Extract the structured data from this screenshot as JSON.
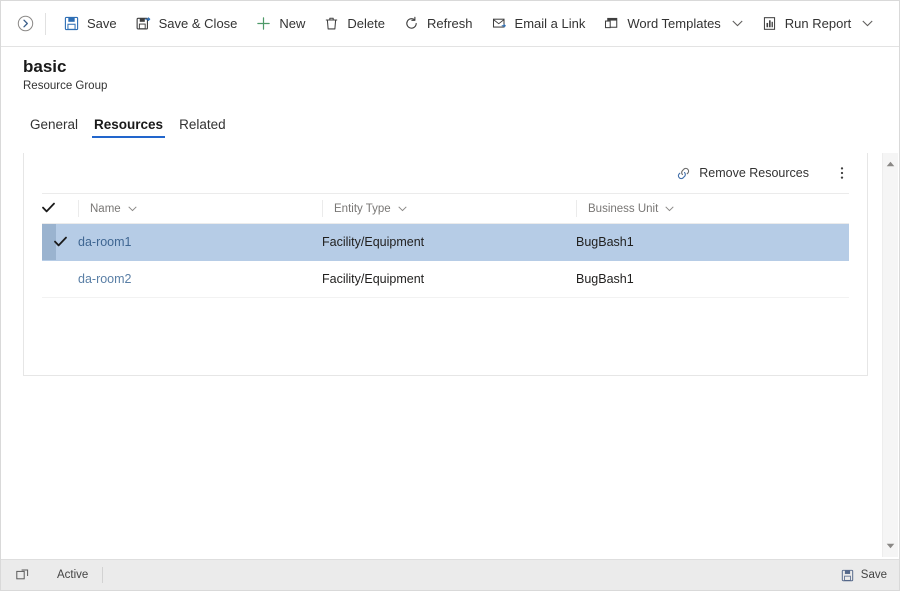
{
  "command_bar": {
    "expand_icon": "chevron-circle-right-icon",
    "buttons": [
      {
        "label": "Save",
        "icon": "save-disk-icon",
        "has_caret": false
      },
      {
        "label": "Save & Close",
        "icon": "save-and-close-icon",
        "has_caret": false
      },
      {
        "label": "New",
        "icon": "plus-icon",
        "has_caret": false
      },
      {
        "label": "Delete",
        "icon": "trash-icon",
        "has_caret": false
      },
      {
        "label": "Refresh",
        "icon": "refresh-icon",
        "has_caret": false
      },
      {
        "label": "Email a Link",
        "icon": "email-link-icon",
        "has_caret": false
      },
      {
        "label": "Word Templates",
        "icon": "word-template-icon",
        "has_caret": true
      },
      {
        "label": "Run Report",
        "icon": "report-chart-icon",
        "has_caret": true
      }
    ]
  },
  "record": {
    "title": "basic",
    "subtitle": "Resource Group"
  },
  "tabs": [
    {
      "label": "General",
      "selected": false
    },
    {
      "label": "Resources",
      "selected": true
    },
    {
      "label": "Related",
      "selected": false
    }
  ],
  "subgrid": {
    "toolbar": {
      "remove_label": "Remove Resources",
      "remove_icon": "remove-link-icon",
      "overflow_icon": "more-vertical-icon"
    },
    "columns": [
      {
        "label": "Name",
        "caret": "chevron-down-icon"
      },
      {
        "label": "Entity Type",
        "caret": "chevron-down-icon"
      },
      {
        "label": "Business Unit",
        "caret": "chevron-down-icon"
      }
    ],
    "select_all_icon": "checkmark-icon",
    "rows": [
      {
        "selected": true,
        "check_icon": "checkmark-icon",
        "name": "da-room1",
        "entity_type": "Facility/Equipment",
        "business_unit": "BugBash1"
      },
      {
        "selected": false,
        "check_icon": "",
        "name": "da-room2",
        "entity_type": "Facility/Equipment",
        "business_unit": "BugBash1"
      }
    ]
  },
  "scrollbar": {
    "up_icon": "caret-up-icon",
    "down_icon": "caret-down-icon"
  },
  "status_bar": {
    "left_icon": "resize-handle-icon",
    "status": "Active",
    "save_label": "Save",
    "save_icon": "save-disk-icon"
  },
  "colors": {
    "accent": "#2266cc",
    "row_selected": "#b6cce6",
    "link": "#5a7fa6",
    "status_bar_bg": "#ebebeb"
  }
}
